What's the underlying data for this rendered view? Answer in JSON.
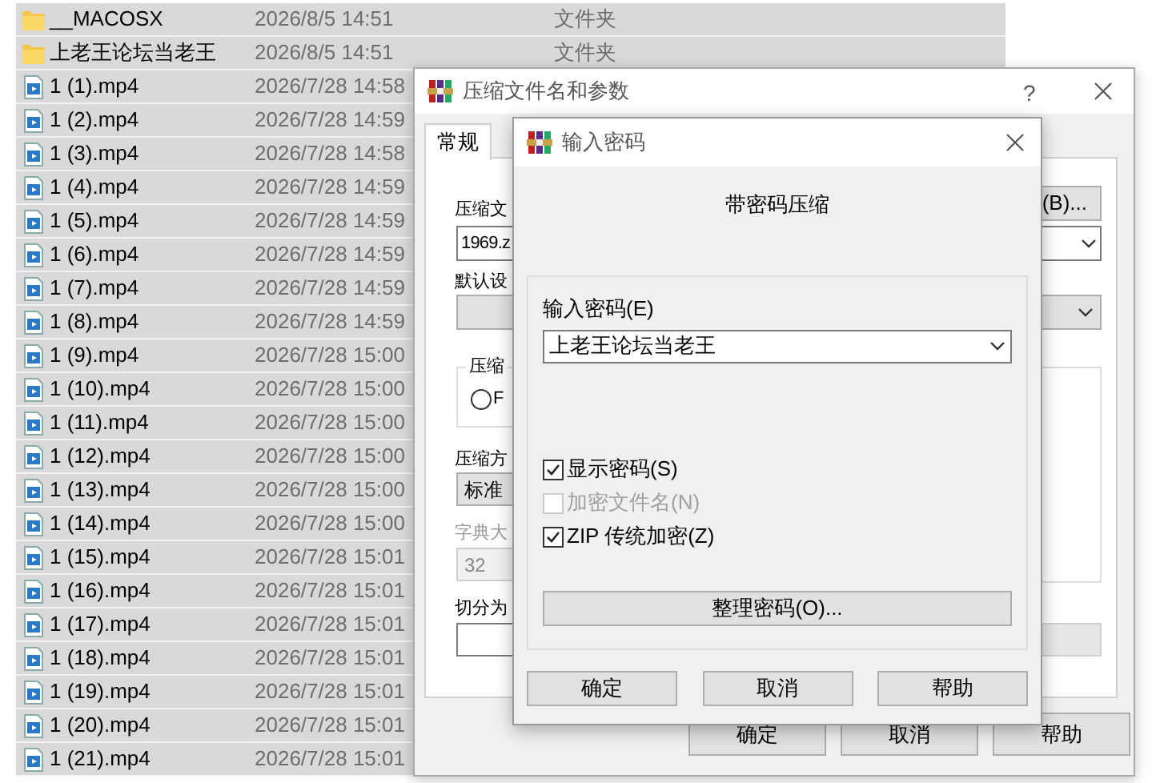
{
  "file_list": {
    "rows": [
      {
        "kind": "folder",
        "name": "__MACOSX",
        "date": "2026/8/5 14:51",
        "type": "文件夹",
        "selected": true
      },
      {
        "kind": "folder",
        "name": "上老王论坛当老王",
        "date": "2026/8/5 14:51",
        "type": "文件夹",
        "selected": true
      },
      {
        "kind": "video",
        "name": "1 (1).mp4",
        "date": "2026/7/28 14:58",
        "selected": true
      },
      {
        "kind": "video",
        "name": "1 (2).mp4",
        "date": "2026/7/28 14:59",
        "selected": true
      },
      {
        "kind": "video",
        "name": "1 (3).mp4",
        "date": "2026/7/28 14:58",
        "selected": true
      },
      {
        "kind": "video",
        "name": "1 (4).mp4",
        "date": "2026/7/28 14:59",
        "selected": true
      },
      {
        "kind": "video",
        "name": "1 (5).mp4",
        "date": "2026/7/28 14:59",
        "selected": true
      },
      {
        "kind": "video",
        "name": "1 (6).mp4",
        "date": "2026/7/28 14:59",
        "selected": true
      },
      {
        "kind": "video",
        "name": "1 (7).mp4",
        "date": "2026/7/28 14:59",
        "selected": true
      },
      {
        "kind": "video",
        "name": "1 (8).mp4",
        "date": "2026/7/28 14:59",
        "selected": true
      },
      {
        "kind": "video",
        "name": "1 (9).mp4",
        "date": "2026/7/28 15:00",
        "selected": true
      },
      {
        "kind": "video",
        "name": "1 (10).mp4",
        "date": "2026/7/28 15:00",
        "selected": true
      },
      {
        "kind": "video",
        "name": "1 (11).mp4",
        "date": "2026/7/28 15:00",
        "selected": true
      },
      {
        "kind": "video",
        "name": "1 (12).mp4",
        "date": "2026/7/28 15:00",
        "selected": true
      },
      {
        "kind": "video",
        "name": "1 (13).mp4",
        "date": "2026/7/28 15:00",
        "selected": true
      },
      {
        "kind": "video",
        "name": "1 (14).mp4",
        "date": "2026/7/28 15:00",
        "selected": true
      },
      {
        "kind": "video",
        "name": "1 (15).mp4",
        "date": "2026/7/28 15:01",
        "selected": true
      },
      {
        "kind": "video",
        "name": "1 (16).mp4",
        "date": "2026/7/28 15:01",
        "selected": true
      },
      {
        "kind": "video",
        "name": "1 (17).mp4",
        "date": "2026/7/28 15:01",
        "selected": true
      },
      {
        "kind": "video",
        "name": "1 (18).mp4",
        "date": "2026/7/28 15:01",
        "selected": true
      },
      {
        "kind": "video",
        "name": "1 (19).mp4",
        "date": "2026/7/28 15:01",
        "selected": true
      },
      {
        "kind": "video",
        "name": "1 (20).mp4",
        "date": "2026/7/28 15:01",
        "selected": true
      },
      {
        "kind": "video",
        "name": "1 (21).mp4",
        "date": "2026/7/28 15:01",
        "selected": true
      }
    ]
  },
  "archive_dialog": {
    "title": "压缩文件名和参数",
    "help": "?",
    "tabs": [
      {
        "label": "常规",
        "selected": true
      }
    ],
    "archive_name_label": "压缩文",
    "browse_button": "(B)...",
    "archive_name": "1969.z",
    "profile_label": "默认设",
    "group_label": "压缩",
    "radio": {
      "label": "F",
      "selected": false
    },
    "method_label": "压缩方",
    "method": "标准",
    "dictionary_label": "字典大",
    "dictionary": "32",
    "split_label": "切分为",
    "buttons": [
      "确定",
      "取消",
      "帮助"
    ]
  },
  "password_dialog": {
    "title": "输入密码",
    "heading": "带密码压缩",
    "password_label": "输入密码(E)",
    "password": "上老王论坛当老王",
    "checkboxes": [
      {
        "label": "显示密码(S)",
        "checked": true,
        "disabled": false
      },
      {
        "label": "加密文件名(N)",
        "checked": false,
        "disabled": true
      },
      {
        "label": "ZIP 传统加密(Z)",
        "checked": true,
        "disabled": false
      }
    ],
    "organize_button": "整理密码(O)...",
    "buttons": [
      "确定",
      "取消",
      "帮助"
    ]
  }
}
